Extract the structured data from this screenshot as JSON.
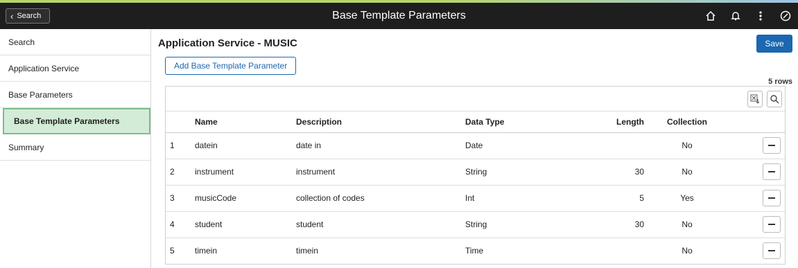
{
  "topbar": {
    "back_label": "Search",
    "title": "Base Template Parameters",
    "icons": [
      "home-icon",
      "bell-icon",
      "more-options-icon",
      "navbar-icon"
    ]
  },
  "sidebar": {
    "items": [
      {
        "label": "Search"
      },
      {
        "label": "Application Service"
      },
      {
        "label": "Base Parameters"
      },
      {
        "label": "Base Template Parameters",
        "active": true
      },
      {
        "label": "Summary"
      }
    ]
  },
  "main": {
    "title": "Application Service - MUSIC",
    "save_label": "Save",
    "add_label": "Add Base Template Parameter",
    "row_count": "5 rows"
  },
  "grid": {
    "columns": [
      "Name",
      "Description",
      "Data Type",
      "Length",
      "Collection"
    ],
    "rows": [
      {
        "num": "1",
        "name": "datein",
        "description": "date in",
        "type": "Date",
        "length": "",
        "collection": "No"
      },
      {
        "num": "2",
        "name": "instrument",
        "description": "instrument",
        "type": "String",
        "length": "30",
        "collection": "No"
      },
      {
        "num": "3",
        "name": "musicCode",
        "description": "collection of codes",
        "type": "Int",
        "length": "5",
        "collection": "Yes"
      },
      {
        "num": "4",
        "name": "student",
        "description": "student",
        "type": "String",
        "length": "30",
        "collection": "No"
      },
      {
        "num": "5",
        "name": "timein",
        "description": "timein",
        "type": "Time",
        "length": "",
        "collection": "No"
      }
    ]
  },
  "colors": {
    "topbar": "#1e1e1e",
    "accent": "#1b67b0",
    "active_bg": "#d3ecd8",
    "active_border": "#78c086"
  }
}
